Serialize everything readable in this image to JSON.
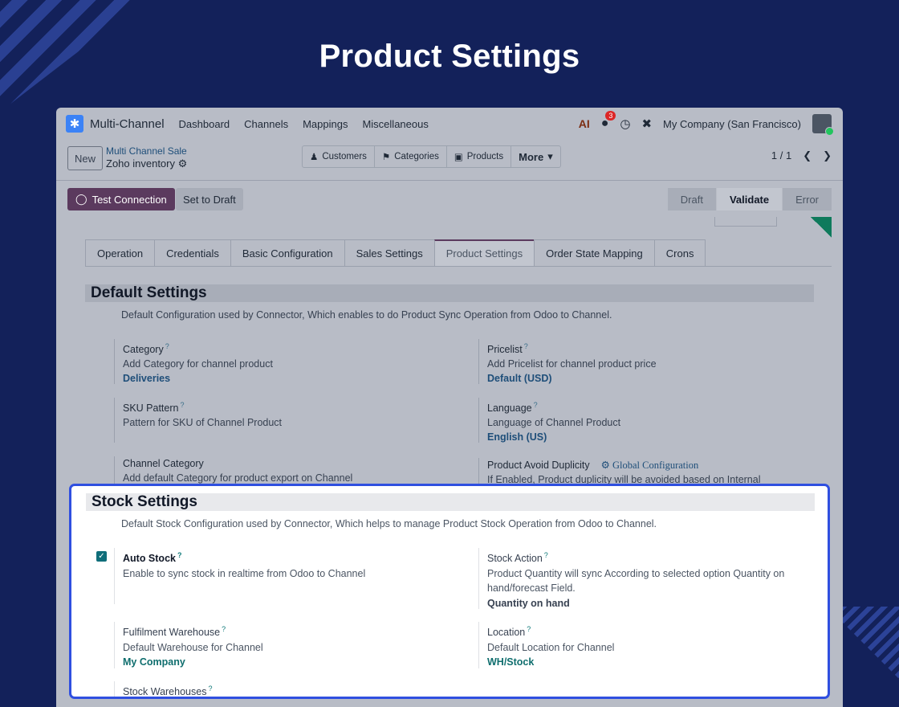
{
  "hero": {
    "title": "Product Settings"
  },
  "navbar": {
    "app_name": "Multi-Channel",
    "menus": [
      "Dashboard",
      "Channels",
      "Mappings",
      "Miscellaneous"
    ],
    "ai_label": "AI",
    "messages_badge": "3",
    "company": "My Company (San Francisco)"
  },
  "control": {
    "new_label": "New",
    "breadcrumb_parent": "Multi Channel Sale",
    "breadcrumb_current": "Zoho inventory",
    "smart_buttons": [
      "Customers",
      "Categories",
      "Products",
      "More"
    ],
    "pager": "1 / 1"
  },
  "status": {
    "test_label": "Test Connection",
    "draft_label": "Set to Draft",
    "stages": [
      "Draft",
      "Validate",
      "Error"
    ]
  },
  "tabs": [
    "Operation",
    "Credentials",
    "Basic Configuration",
    "Sales Settings",
    "Product Settings",
    "Order State Mapping",
    "Crons"
  ],
  "default_settings": {
    "title": "Default Settings",
    "desc": "Default Configuration used by Connector, Which enables to do Product Sync Operation from Odoo to Channel.",
    "category": {
      "label": "Category",
      "help": "Add Category for channel product",
      "value": "Deliveries"
    },
    "pricelist": {
      "label": "Pricelist",
      "help": "Add Pricelist for channel product price",
      "value": "Default (USD)"
    },
    "sku": {
      "label": "SKU Pattern",
      "help": "Pattern for SKU of Channel Product"
    },
    "language": {
      "label": "Language",
      "help": "Language of Channel Product",
      "value": "English (US)"
    },
    "channel_category": {
      "label": "Channel Category",
      "help": "Add default Category for product export on Channel"
    },
    "avoid_dup": {
      "label": "Product Avoid Duplicity",
      "link": "Global Configuration",
      "help": "If Enabled, Product duplicity will be avoided based on Internal"
    }
  },
  "stock_settings": {
    "title": "Stock Settings",
    "desc": "Default Stock Configuration used by Connector, Which helps to manage Product Stock Operation from Odoo to Channel.",
    "auto_stock": {
      "label": "Auto Stock",
      "help": "Enable to sync stock in realtime from Odoo to Channel",
      "checked": true
    },
    "stock_action": {
      "label": "Stock Action",
      "help1": "Product Quantity will sync According to selected option Quantity on",
      "help2": "hand/forecast Field.",
      "value": "Quantity on hand"
    },
    "warehouse": {
      "label": "Fulfilment Warehouse",
      "help": "Default Warehouse for Channel",
      "value": "My Company"
    },
    "location": {
      "label": "Location",
      "help": "Default Location for Channel",
      "value": "WH/Stock"
    },
    "stock_warehouses": {
      "label": "Stock Warehouses"
    }
  },
  "colors": {
    "brand_bg": "#13215a",
    "highlight": "#2f4fe0",
    "primary": "#5b3a5e",
    "teal": "#0f6e6e"
  }
}
